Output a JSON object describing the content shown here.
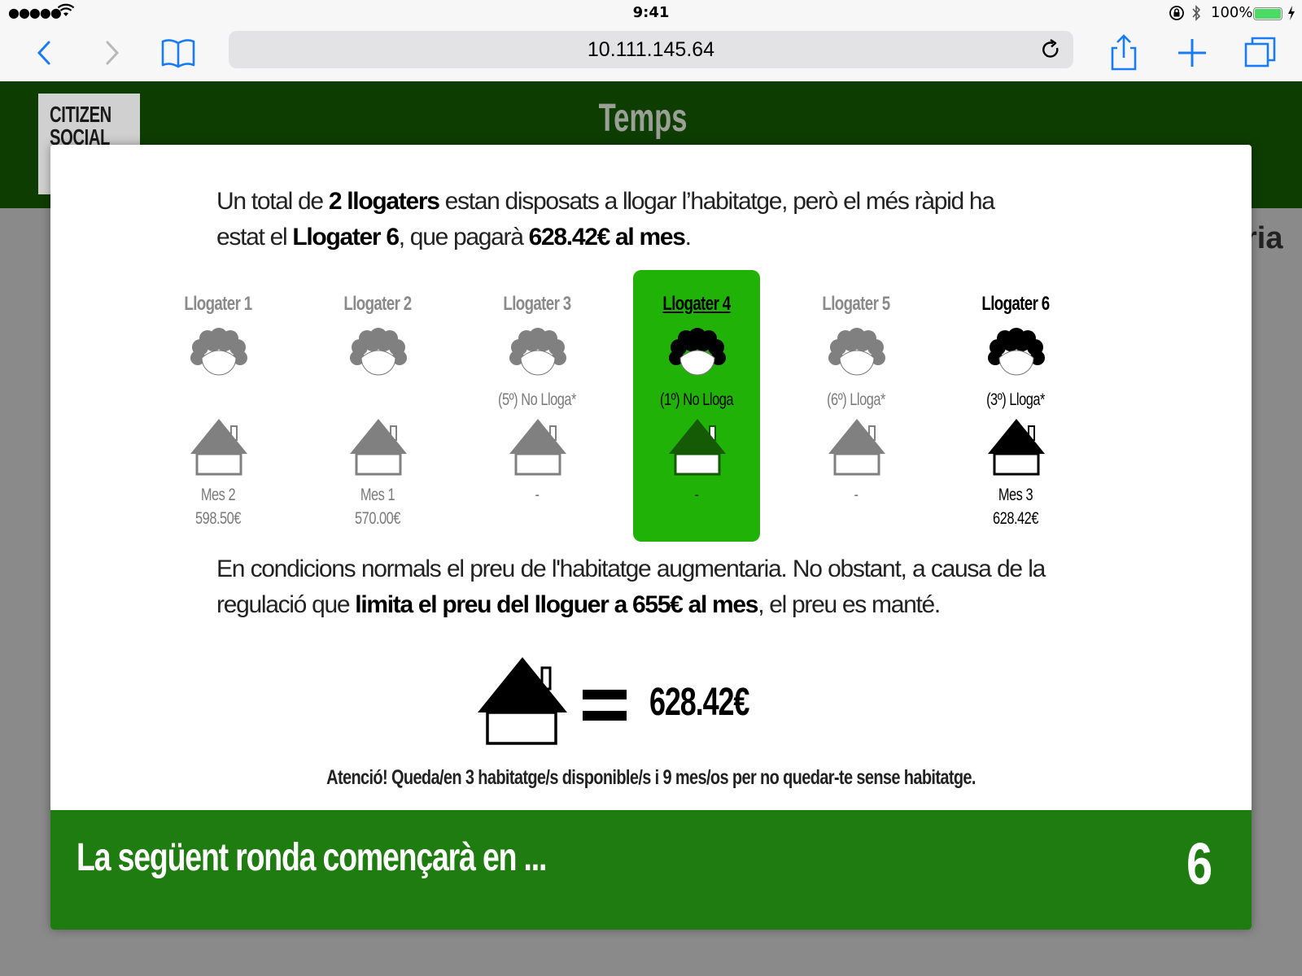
{
  "status_bar": {
    "signal": "●●●●●",
    "time": "9:41",
    "battery": "100%"
  },
  "browser": {
    "url": "10.111.145.64"
  },
  "page": {
    "logo_line1": "CITIZEN",
    "logo_line2": "SOCIAL",
    "title": "Temps",
    "background_fragment": "ria"
  },
  "modal": {
    "intro": {
      "part1": "Un total de ",
      "count_bold": "2 llogaters",
      "part2": " estan disposats a llogar l’habitatge, però el més ràpid ha estat el ",
      "winner_bold": "Llogater 6",
      "part3": ", que pagarà ",
      "price_bold": "628.42€ al mes",
      "part4": "."
    },
    "tenants": [
      {
        "name": "Llogater 1",
        "status": "",
        "month": "Mes 2",
        "amount": "598.50€",
        "style": "inactive"
      },
      {
        "name": "Llogater 2",
        "status": "",
        "month": "Mes 1",
        "amount": "570.00€",
        "style": "inactive"
      },
      {
        "name": "Llogater 3",
        "status": "(5º) No Lloga*",
        "month": "-",
        "amount": "",
        "style": "inactive"
      },
      {
        "name": "Llogater 4",
        "status": "(1º) No Lloga",
        "month": "-",
        "amount": "",
        "style": "current-player"
      },
      {
        "name": "Llogater 5",
        "status": "(6º) Lloga*",
        "month": "-",
        "amount": "",
        "style": "inactive"
      },
      {
        "name": "Llogater 6",
        "status": "(3º) Lloga*",
        "month": "Mes 3",
        "amount": "628.42€",
        "style": "winner"
      }
    ],
    "regulation": {
      "part1": "En condicions normals el preu de l'habitatge augmentaria. No obstant, a causa de la regulació que ",
      "bold": "limita el preu del lloguer a 655€ al mes",
      "part2": ", el preu es manté."
    },
    "final_price": "628.42€",
    "warning": "Atenció! Queda/en 3 habitatge/s disponible/s i 9 mes/os per no quedar-te sense habitatge.",
    "countdown": {
      "label": "La següent ronda començarà en ...",
      "value": "6"
    }
  },
  "colors": {
    "header_green": "#0e3d02",
    "highlight_green": "#21b208",
    "countdown_green": "#1e7c10",
    "inactive_gray": "#808080",
    "ios_blue": "#1a7cf5"
  }
}
